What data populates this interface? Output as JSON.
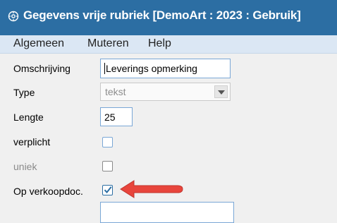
{
  "window": {
    "title": "Gegevens vrije rubriek  [DemoArt : 2023 : Gebruik]",
    "icon": "gear-icon"
  },
  "menu": {
    "items": [
      "Algemeen",
      "Muteren",
      "Help"
    ]
  },
  "form": {
    "omschrijving": {
      "label": "Omschrijving",
      "value": "Leverings opmerking"
    },
    "type": {
      "label": "Type",
      "value": "tekst"
    },
    "lengte": {
      "label": "Lengte",
      "value": "25"
    },
    "verplicht": {
      "label": "verplicht",
      "checked": false
    },
    "uniek": {
      "label": "uniek",
      "checked": false,
      "disabled": true
    },
    "op_verkoopdoc": {
      "label": "Op verkoopdoc.",
      "checked": true
    }
  },
  "annotation": {
    "color": "#e8453c",
    "icon": "arrow-left-icon"
  },
  "colors": {
    "titlebar": "#2c6ea3",
    "menubar": "#dbe7f4",
    "field_border": "#7aa7d6"
  }
}
